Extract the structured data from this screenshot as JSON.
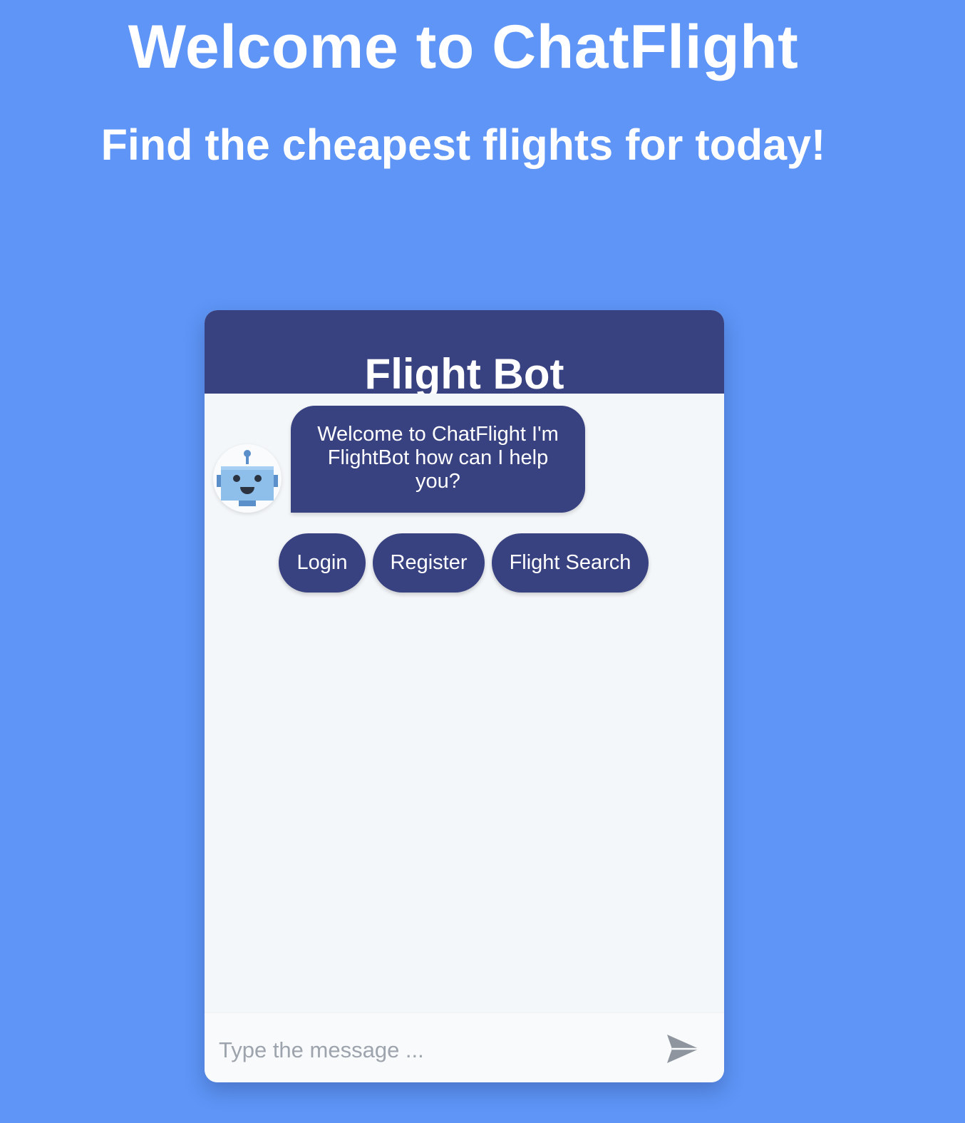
{
  "colors": {
    "page_background": "#5e95f6",
    "accent_navy": "#394280",
    "chat_background": "#f4f7fa"
  },
  "hero": {
    "title": "Welcome to ChatFlight",
    "subtitle": "Find the cheapest flights for today!"
  },
  "chat": {
    "title": "Flight Bot",
    "avatar_icon": "robot-icon",
    "messages": [
      {
        "sender": "bot",
        "text": "Welcome to ChatFlight I'm FlightBot how can I help you?"
      }
    ],
    "quick_replies": [
      {
        "label": "Login"
      },
      {
        "label": "Register"
      },
      {
        "label": "Flight Search"
      }
    ],
    "composer": {
      "placeholder": "Type the message ...",
      "send_icon": "send-icon"
    }
  }
}
